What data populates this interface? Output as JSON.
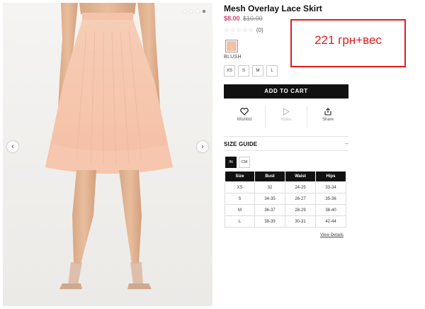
{
  "product": {
    "title": "Mesh Overlay Lace Skirt",
    "sale_price": "$8.00",
    "original_price": "$10.00",
    "rating_stars": "☆☆☆☆☆",
    "review_count": "(0)",
    "color_name": "BLUSH",
    "swatch_color": "#f3c1ab"
  },
  "sizes": [
    "XS",
    "S",
    "M",
    "L"
  ],
  "cart": {
    "add_label": "ADD TO CART"
  },
  "actions": {
    "wishlist": "Wishlist",
    "video": "Video",
    "share": "Share"
  },
  "size_guide": {
    "title": "SIZE GUIDE",
    "toggle": "–",
    "units": [
      "IN",
      "CM"
    ],
    "headers": [
      "Size",
      "Bust",
      "Waist",
      "Hips"
    ],
    "rows": [
      [
        "XS",
        "32",
        "24-25",
        "33-34"
      ],
      [
        "S",
        "34-35",
        "26-27",
        "35-36"
      ],
      [
        "M",
        "36-37",
        "28-29",
        "38-40"
      ],
      [
        "L",
        "38-39",
        "30-31",
        "42-44"
      ]
    ],
    "view_details": "View Details"
  },
  "gallery": {
    "prev": "‹",
    "next": "›"
  },
  "annotation": {
    "text": "221 грн+вес"
  },
  "colors": {
    "accent_price": "#d2466b",
    "annotation_red": "#e51b1b",
    "button_black": "#111111"
  }
}
